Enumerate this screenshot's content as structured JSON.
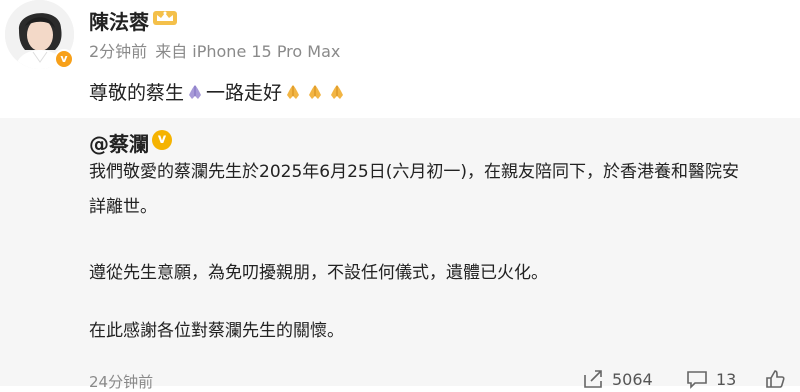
{
  "post": {
    "username": "陳法蓉",
    "time": "2分钟前",
    "device": "来自 iPhone 15 Pro Max",
    "text_part1": "尊敬的蔡生",
    "text_part2": "一路走好",
    "avatar_badge": "v"
  },
  "repost": {
    "author": "@蔡瀾",
    "verified_mark": "v",
    "line1": "我們敬愛的蔡瀾先生於2025年6月25日(六月初一)，在親友陪同下，於香港養和醫院安",
    "line2": "詳離世。",
    "line3": "遵從先生意願，為免叨擾親朋，不設任何儀式，遺體已火化。",
    "line4": "在此感謝各位對蔡瀾先生的關懷。",
    "time": "24分钟前",
    "share_count": "5064",
    "comment_count": "13"
  },
  "colors": {
    "repost_bg": "#f6f6f6",
    "meta_gray": "#8a8a8a",
    "verified_gold": "#f5b301",
    "avatar_badge_orange": "#f7a019"
  },
  "icons": [
    "crown-icon",
    "praying-hands-icon",
    "verified-icon",
    "share-icon",
    "comment-icon",
    "like-icon"
  ]
}
